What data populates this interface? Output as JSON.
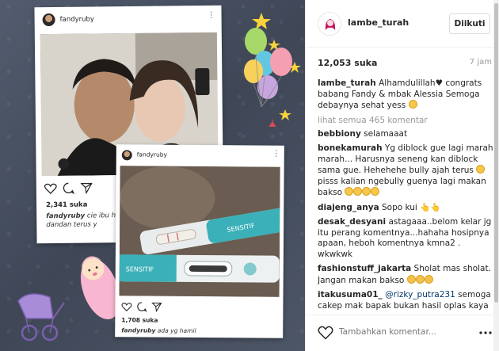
{
  "post": {
    "account": "lambe_turah",
    "follow_label": "Diikuti",
    "likes": "12,053 suka",
    "age": "7 jam",
    "view_all": "lihat semua 465 komentar",
    "add_comment_placeholder": "Tambahkan komentar..."
  },
  "caption": {
    "user": "lambe_turah",
    "text": "Alhamdulillah♥ congrats babang Fandy & mbak Alessia Semoga debaynya sehat yess"
  },
  "comments": [
    {
      "user": "bebbiony",
      "text": "selamaaat"
    },
    {
      "user": "bonekamurah",
      "text": "Yg diblock gue lagi marah marah... Harusnya seneng kan diblock sama gue. Hehehehe bully ajah terus",
      "text2": "pisss kalian ngebully guenya lagi makan bakso"
    },
    {
      "user": "diajeng_anya",
      "text": "Sopo kui"
    },
    {
      "user": "desak_desyani",
      "text": "astagaaa..belom kelar jg itu perang komentnya...hahaha hosipnya apaan, heboh komentnya kmna2 . wkwkwk"
    },
    {
      "user": "fashionstuff_jakarta",
      "text": "Sholat mas sholat. Jangan makan bakso"
    },
    {
      "user": "itakusuma01_",
      "mention": "@rizky_putra231",
      "text": "semoga cakep mak bapak bukan hasil oplas kaya"
    }
  ],
  "media": {
    "card1": {
      "username": "fandyruby",
      "likes": "2,341 suka",
      "caption_user": "fandyruby",
      "caption": "cie ibu hamil.. dandan terus y"
    },
    "card2": {
      "username": "fandyruby",
      "likes": "1,708 suka",
      "caption_user": "fandyruby",
      "caption": "ada yg hamil"
    },
    "test_brand": "SENSITIF"
  },
  "icons": {
    "heart": "heart-icon",
    "comment": "comment-icon",
    "share": "share-icon",
    "more": "more-icon"
  }
}
